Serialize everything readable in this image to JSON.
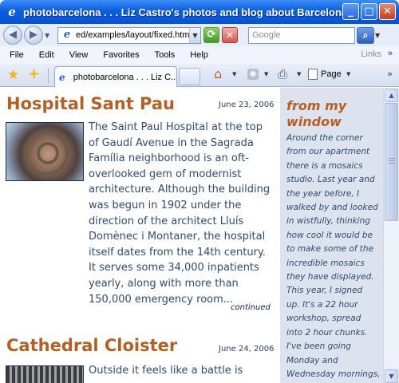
{
  "window": {
    "title": "photobarcelona . . . Liz Castro's photos and blog about Barcelona - ..."
  },
  "address_bar": {
    "url": "ed/examples/layout/fixed.html",
    "search_placeholder": "Google"
  },
  "menu": {
    "items": [
      "File",
      "Edit",
      "View",
      "Favorites",
      "Tools",
      "Help"
    ],
    "links_label": "Links"
  },
  "tabbar": {
    "active_tab_title": "photobarcelona . . . Liz C...",
    "page_label": "Page"
  },
  "posts": [
    {
      "title": "Hospital Sant Pau",
      "date": "June 23, 2006",
      "body_lines": [
        "The Saint Paul Hospital at the top",
        "of Gaudí Avenue in the Sagrada",
        "Família neighborhood is an oft-",
        "overlooked gem of modernist",
        "architecture. Although the building",
        "was begun in 1902 under the",
        "direction of the architect Lluís",
        "Domènec i Montaner, the hospital",
        "itself dates from the 14th century.",
        "It serves some 34,000 inpatients",
        "yearly, along with more than",
        "150,000 emergency room..."
      ],
      "continued_label": "continued"
    },
    {
      "title": "Cathedral Cloister",
      "date": "June 24, 2006",
      "body_lines": [
        "Outside it feels like a battle is"
      ]
    }
  ],
  "sidebar": {
    "heading_lines": [
      "from my",
      "window"
    ],
    "body_lines": [
      "Around the corner",
      "from our apartment",
      "there is a mosaics",
      "studio. Last year and",
      "the year before, I",
      "walked by and looked",
      "in wistfully, thinking",
      "how cool it would be",
      "to make some of the",
      "incredible mosaics",
      "they have displayed.",
      "This year, I signed",
      "up. It's a 22 hour",
      "workshop, spread",
      "into 2 hour chunks.",
      "I've been going",
      "Monday and",
      "Wednesday mornings,"
    ]
  },
  "colors": {
    "title_bar": "#0a5fe0",
    "heading": "#b55f23",
    "body_text": "#2e4a72",
    "sidebar_bg": "#dde3ee"
  }
}
